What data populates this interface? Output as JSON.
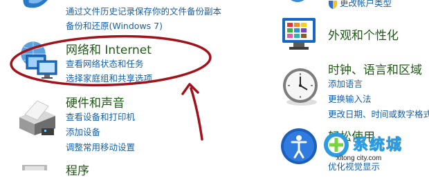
{
  "colors": {
    "category_title": "#1e5a14",
    "link": "#1560a8",
    "annotation": "#a1121a",
    "watermark": "#2e9be0"
  },
  "left_column": {
    "system_security": {
      "links": [
        "通过文件历史记录保存你的文件备份副本",
        "备份和还原(Windows 7)"
      ]
    },
    "network": {
      "title": "网络和 Internet",
      "links": [
        "查看网络状态和任务",
        "选择家庭组和共享选项"
      ],
      "icon": "network-monitors-icon"
    },
    "hardware": {
      "title": "硬件和声音",
      "links": [
        "查看设备和打印机",
        "添加设备",
        "调整常用移动设置"
      ],
      "icon": "printer-icon"
    },
    "programs": {
      "title": "程序",
      "icon": "programs-icon"
    }
  },
  "right_column": {
    "user_accounts": {
      "links": [
        "更改帐户类型"
      ]
    },
    "appearance": {
      "title": "外观和个性化",
      "icon": "appearance-palette-icon"
    },
    "clock_region": {
      "title": "时钟、语言和区域",
      "links": [
        "添加语言",
        "更换输入法",
        "更改日期、时间或数字格式"
      ],
      "icon": "clock-icon"
    },
    "ease_access": {
      "title": "轻松使用",
      "links": [
        "优化视觉显示"
      ],
      "icon": "ease-of-access-icon"
    }
  },
  "watermark": {
    "brand": "系统城",
    "url": "xitong city.com"
  }
}
